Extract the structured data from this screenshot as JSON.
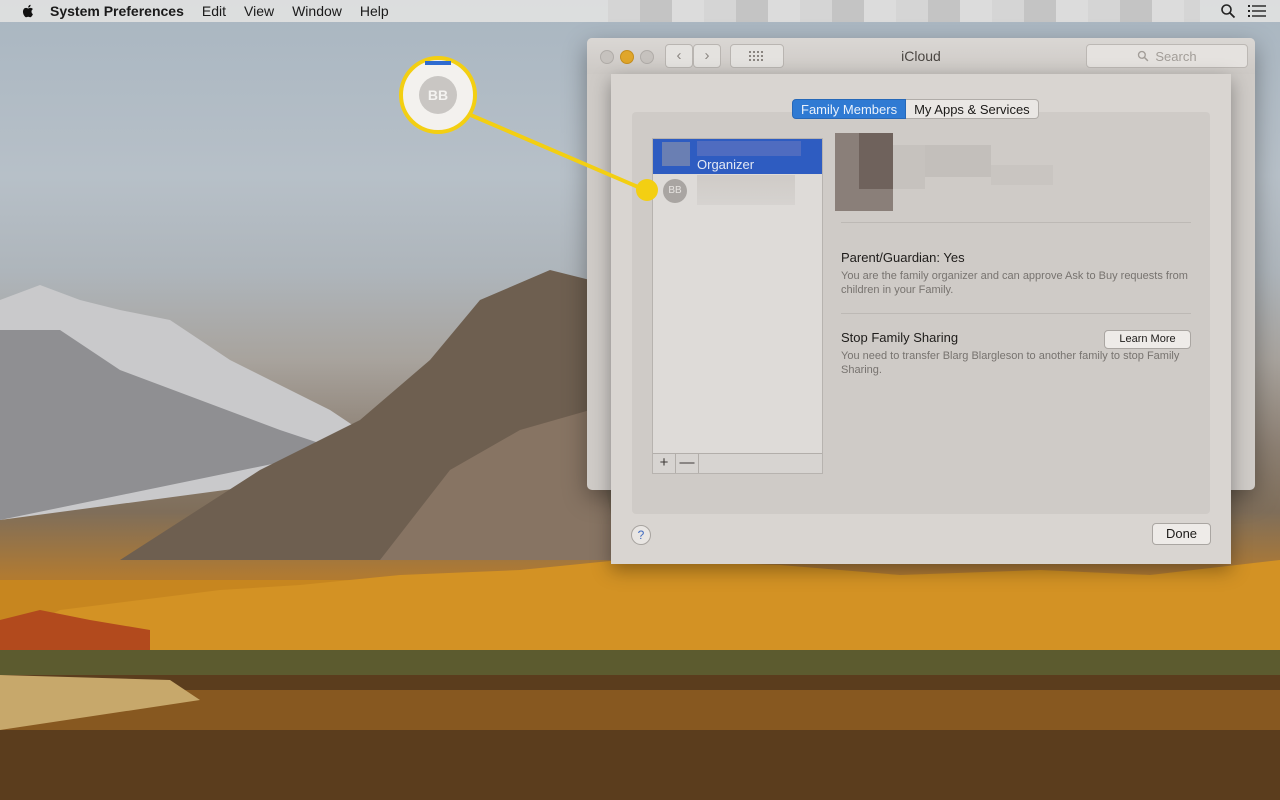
{
  "menubar": {
    "app_name": "System Preferences",
    "menus": [
      "Edit",
      "View",
      "Window",
      "Help"
    ]
  },
  "icons": {
    "apple": "apple-logo",
    "spotlight": "search-icon",
    "notifications": "list-icon",
    "back": "chevron-left-icon",
    "forward": "chevron-right-icon",
    "show_all": "grid-icon",
    "add": "plus-icon",
    "remove": "minus-icon",
    "help": "question-icon"
  },
  "window": {
    "title": "iCloud",
    "search_placeholder": "Search"
  },
  "sheet": {
    "tabs": [
      "Family Members",
      "My Apps & Services"
    ],
    "selected_tab": "Family Members",
    "members": [
      {
        "role": "Organizer",
        "selected": true
      },
      {
        "initials": "BB",
        "selected": false
      }
    ],
    "add_label": "+",
    "remove_label": "—",
    "parent_heading": "Parent/Guardian: Yes",
    "parent_text": "You are the family organizer and can approve Ask to Buy requests from children in your Family.",
    "stop_heading": "Stop Family Sharing",
    "stop_text": "You need to transfer Blarg Blargleson to another family to stop Family Sharing.",
    "learn_more_label": "Learn More",
    "help_label": "?",
    "done_label": "Done"
  },
  "callout": {
    "initials": "BB",
    "color": "#f3cf12"
  }
}
